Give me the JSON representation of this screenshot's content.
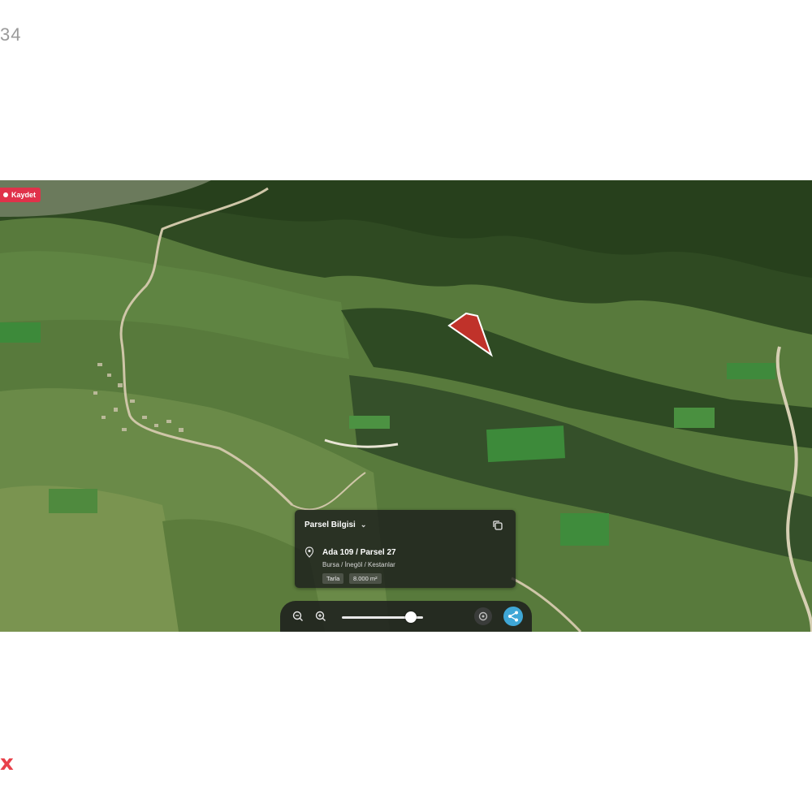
{
  "page": {
    "corner_code": "34",
    "corner_mark": "x"
  },
  "map": {
    "record_badge": "Kaydet",
    "parcel_color": "#c0322a",
    "accent": "#3fa7d6"
  },
  "parcel_card": {
    "header": "Parsel Bilgisi",
    "title": "Ada 109 / Parsel 27",
    "address": "Bursa / İnegöl / Kestanlar",
    "tags": [
      "Tarla",
      "8.000 m²"
    ]
  },
  "controls": {
    "zoom_level": 0.85,
    "icons": [
      "zoom-out-icon",
      "zoom-in-icon",
      "layers-icon",
      "share-icon"
    ]
  }
}
